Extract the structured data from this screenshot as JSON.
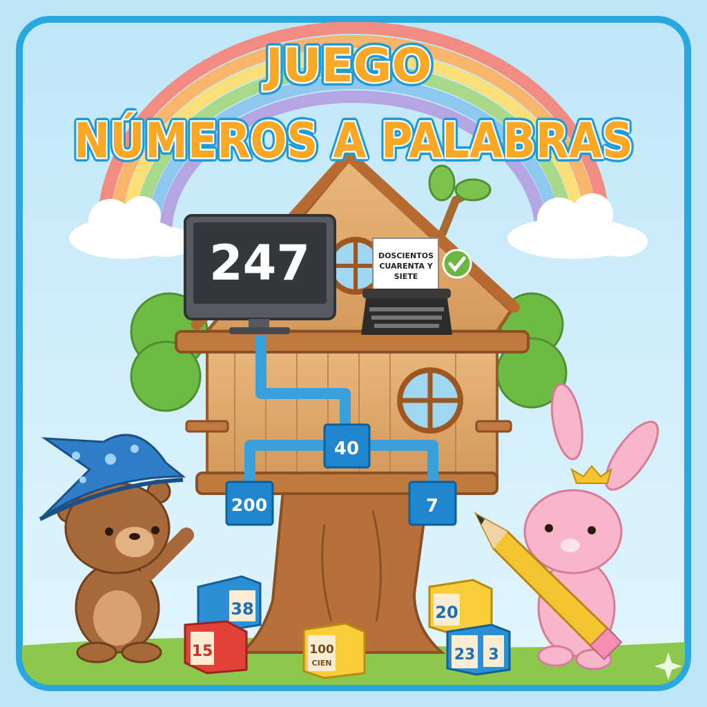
{
  "title": {
    "line1": "JUEGO",
    "line2": "NÚMEROS A PALABRAS"
  },
  "monitor": {
    "number": "247"
  },
  "typewriter": {
    "paper_line1": "DOSCIENTOS",
    "paper_line2": "CUARENTA Y",
    "paper_line3": "SIETE"
  },
  "decomposition": {
    "hundreds": "200",
    "tens": "40",
    "units": "7"
  },
  "blocks": [
    {
      "label": "38"
    },
    {
      "label": "15"
    },
    {
      "label": "100",
      "sublabel": "CIEN"
    },
    {
      "label": "20"
    },
    {
      "label": "23",
      "side_label": "3"
    }
  ],
  "colors": {
    "frame": "#29a8e0",
    "sky": "#d6f0fb",
    "title": "#f9a825",
    "pipe": "#3aa0dc",
    "grass": "#8cc84b"
  },
  "icons": [
    "check-icon",
    "sparkle-icon",
    "star-icon"
  ]
}
